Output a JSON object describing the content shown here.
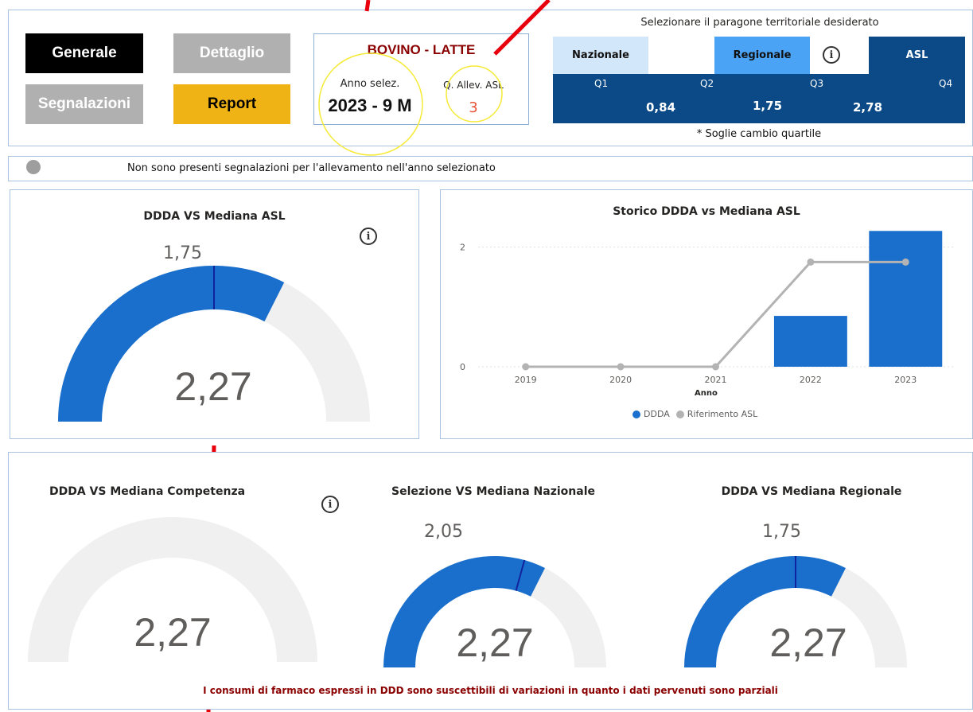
{
  "nav": {
    "generale": "Generale",
    "dettaglio": "Dettaglio",
    "segnalazioni": "Segnalazioni",
    "report": "Report"
  },
  "header_card": {
    "title": "BOVINO - LATTE",
    "anno_label": "Anno selez.",
    "anno_value": "2023 - 9 M",
    "quartile_label": "Q. Allev. ASL",
    "quartile_value": "3"
  },
  "territorial": {
    "prompt": "Selezionare il paragone territoriale desiderato",
    "options": [
      "Nazionale",
      "Regionale",
      "ASL"
    ],
    "quartiles": [
      "Q1",
      "Q2",
      "Q3",
      "Q4"
    ],
    "thresholds": [
      "0,84",
      "1,75",
      "2,78"
    ],
    "footnote": "* Soglie cambio quartile"
  },
  "alert": {
    "text": "Non sono presenti segnalazioni per l'allevamento nell'anno selezionato"
  },
  "gauges": {
    "asl": {
      "title": "DDDA VS Mediana ASL",
      "target_label": "1,75",
      "value_label": "2,27",
      "value": 2.27,
      "target": 1.75,
      "max": 3.5
    },
    "competenza": {
      "title": "DDDA VS Mediana Competenza",
      "value_label": "2,27",
      "value": 2.27,
      "max": 3.5
    },
    "nazionale": {
      "title": "Selezione VS Mediana Nazionale",
      "target_label": "2,05",
      "value_label": "2,27",
      "value": 2.27,
      "target": 2.05,
      "max": 3.5
    },
    "regionale": {
      "title": "DDDA VS Mediana Regionale",
      "target_label": "1,75",
      "value_label": "2,27",
      "value": 2.27,
      "target": 1.75,
      "max": 3.5
    }
  },
  "chart_data": {
    "type": "bar",
    "title": "Storico DDDA vs Mediana ASL",
    "xlabel": "Anno",
    "ylabel": "",
    "categories": [
      "2019",
      "2020",
      "2021",
      "2022",
      "2023"
    ],
    "series": [
      {
        "name": "DDDA",
        "type": "bar",
        "color": "#1a6fcc",
        "values": [
          0,
          0,
          0,
          0.85,
          2.27
        ]
      },
      {
        "name": "Riferimento ASL",
        "type": "line",
        "color": "#b3b3b3",
        "values": [
          0,
          0,
          0,
          1.75,
          1.75
        ]
      }
    ],
    "yticks": [
      "0",
      "2"
    ],
    "ylim": [
      0,
      2.5
    ],
    "grid": true,
    "legend": "bottom"
  },
  "footer": {
    "note": "I consumi di farmaco espressi in DDD sono suscettibili di variazioni in quanto i dati pervenuti sono parziali"
  },
  "colors": {
    "accent_blue": "#1a6fcc",
    "dark_blue": "#0b4a86",
    "light_blue": "#d3e7fa",
    "mid_blue": "#4ba3f5",
    "report_yellow": "#f0b316",
    "maroon": "#8b0000",
    "orange_red": "#e8553a",
    "track_gray": "#f0f0f0"
  }
}
